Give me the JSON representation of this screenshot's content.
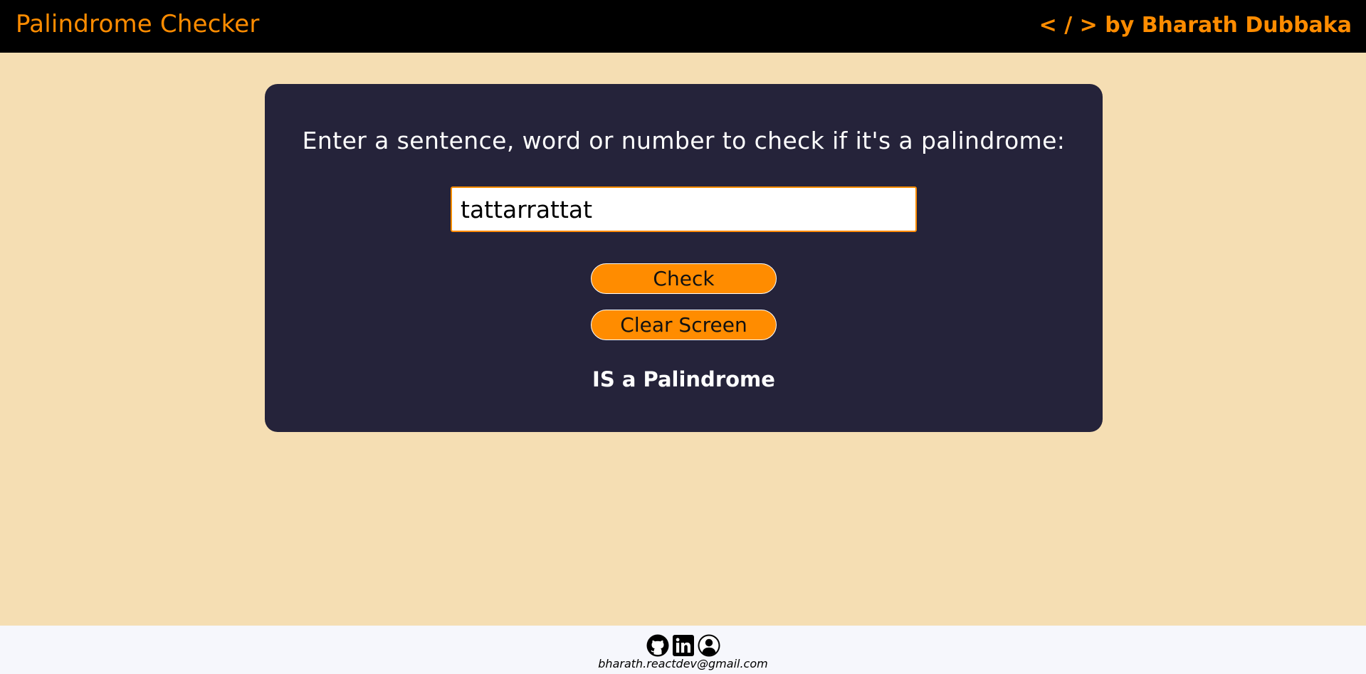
{
  "header": {
    "title": "Palindrome Checker",
    "byline": "< / > by Bharath Dubbaka"
  },
  "main": {
    "prompt": "Enter a sentence, word or number to check if it's a palindrome:",
    "input_value": "tattarrattat",
    "check_label": "Check",
    "clear_label": "Clear Screen",
    "result": "IS a Palindrome"
  },
  "footer": {
    "icons": [
      "github-icon",
      "linkedin-icon",
      "profile-icon"
    ],
    "email": "bharath.reactdev@gmail.com"
  },
  "colors": {
    "accent": "#ff8c00",
    "background": "#f5deb3",
    "card": "#25233a",
    "header": "#000000",
    "footer": "#f6f7fc"
  }
}
